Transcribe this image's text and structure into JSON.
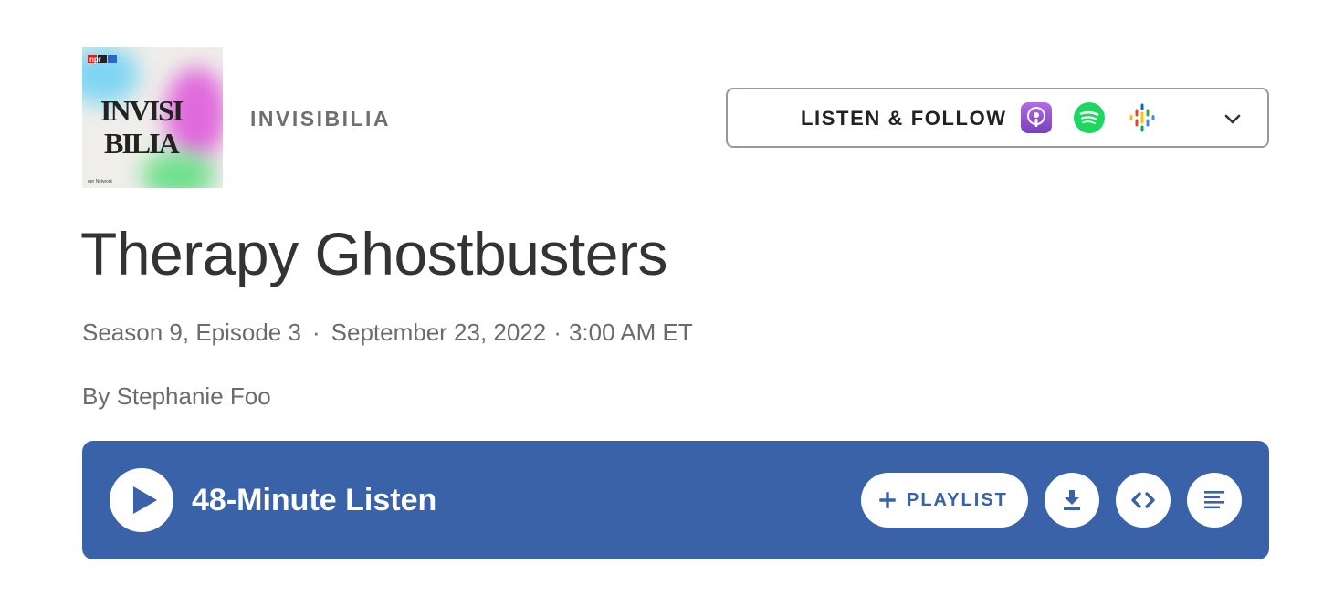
{
  "podcast": {
    "name": "INVISIBILIA",
    "art": {
      "network_badge": "npr",
      "title_line1": "INVISI",
      "title_line2": "BILIA",
      "footer_text": "npr Network"
    }
  },
  "listen_follow": {
    "label": "LISTEN & FOLLOW",
    "services": [
      "apple-podcasts-icon",
      "spotify-icon",
      "google-podcasts-icon"
    ]
  },
  "episode": {
    "title": "Therapy Ghostbusters",
    "season_episode": "Season 9, Episode 3",
    "separator": "·",
    "date": "September 23, 2022",
    "time": "3:00 AM ET",
    "byline": "By Stephanie Foo"
  },
  "player": {
    "duration_label": "48-Minute Listen",
    "playlist_label": "PLAYLIST",
    "accent_color": "#3a62a8"
  }
}
